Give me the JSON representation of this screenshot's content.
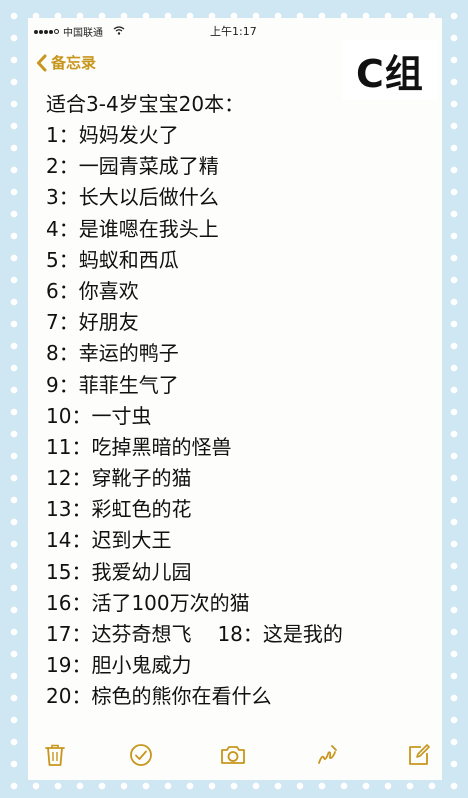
{
  "status_bar": {
    "carrier": "中国联通",
    "wifi_icon": "wifi-icon",
    "time": "上午1:17"
  },
  "nav": {
    "back_label": "备忘录",
    "back_icon": "chevron-left-icon"
  },
  "group_badge": "C组",
  "note": {
    "title": "适合3-4岁宝宝20本：",
    "books": [
      {
        "num": "1：",
        "title": "妈妈发火了"
      },
      {
        "num": "2：",
        "title": "一园青菜成了精"
      },
      {
        "num": "3：",
        "title": "长大以后做什么"
      },
      {
        "num": "4：",
        "title": "是谁嗯在我头上"
      },
      {
        "num": "5：",
        "title": "蚂蚁和西瓜"
      },
      {
        "num": "6：",
        "title": "你喜欢"
      },
      {
        "num": "7：",
        "title": "好朋友"
      },
      {
        "num": "8：",
        "title": "幸运的鸭子"
      },
      {
        "num": "9：",
        "title": "菲菲生气了"
      },
      {
        "num": "10：",
        "title": "一寸虫"
      },
      {
        "num": "11：",
        "title": "吃掉黑暗的怪兽"
      },
      {
        "num": "12：",
        "title": "穿靴子的猫"
      },
      {
        "num": "13：",
        "title": "彩虹色的花"
      },
      {
        "num": "14：",
        "title": "迟到大王"
      },
      {
        "num": "15：",
        "title": "我爱幼儿园"
      },
      {
        "num": "16：",
        "title": "活了100万次的猫"
      },
      {
        "num": "17：",
        "title": "达芬奇想飞"
      },
      {
        "num": "19：",
        "title": "胆小鬼威力"
      },
      {
        "num": "20：",
        "title": "棕色的熊你在看什么"
      }
    ],
    "extra_on_line_17": {
      "num": "18：",
      "title": "这是我的"
    }
  },
  "toolbar": {
    "icons": [
      "trash-icon",
      "checkmark-icon",
      "camera-icon",
      "sketch-icon",
      "compose-icon"
    ]
  },
  "colors": {
    "accent": "#c8961d",
    "note_background": "#fdfdfb",
    "page_background": "#cfe6f3"
  }
}
